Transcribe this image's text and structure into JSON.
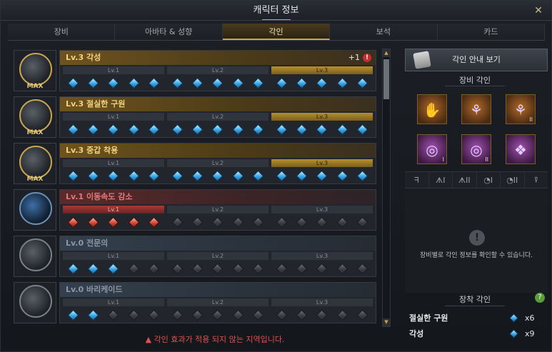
{
  "window": {
    "title": "캐릭터 정보"
  },
  "tabs": [
    {
      "label": "장비",
      "active": false
    },
    {
      "label": "아바타 & 성향",
      "active": false
    },
    {
      "label": "각인",
      "active": true
    },
    {
      "label": "보석",
      "active": false
    },
    {
      "label": "카드",
      "active": false
    }
  ],
  "engravings": [
    {
      "name": "Lv.3 각성",
      "style": "gold",
      "badge": "MAX",
      "extra": "+1",
      "lv1": "Lv.1",
      "lv2": "Lv.2",
      "lv3": "Lv.3",
      "active_level": 3,
      "filled": 15,
      "gem": "blue"
    },
    {
      "name": "Lv.3 절실한 구원",
      "style": "gold",
      "badge": "MAX",
      "extra": "",
      "lv1": "Lv.1",
      "lv2": "Lv.2",
      "lv3": "Lv.3",
      "active_level": 3,
      "filled": 15,
      "gem": "blue"
    },
    {
      "name": "Lv.3 중갑 착용",
      "style": "gold",
      "badge": "MAX",
      "extra": "",
      "lv1": "Lv.1",
      "lv2": "Lv.2",
      "lv3": "Lv.3",
      "active_level": 3,
      "filled": 15,
      "gem": "blue"
    },
    {
      "name": "Lv.1 이동속도 감소",
      "style": "red",
      "badge": "",
      "extra": "",
      "lv1": "Lv.1",
      "lv2": "Lv.2",
      "lv3": "Lv.3",
      "active_level": 1,
      "filled": 5,
      "gem": "red"
    },
    {
      "name": "Lv.0 전문의",
      "style": "grey",
      "badge": "",
      "extra": "",
      "lv1": "Lv.1",
      "lv2": "Lv.2",
      "lv3": "Lv.3",
      "active_level": 0,
      "filled": 3,
      "gem": "blue"
    },
    {
      "name": "Lv.0 바리케이드",
      "style": "grey",
      "badge": "",
      "extra": "",
      "lv1": "Lv.1",
      "lv2": "Lv.2",
      "lv3": "Lv.3",
      "active_level": 0,
      "filled": 2,
      "gem": "blue"
    }
  ],
  "footer_warning": "각인 효과가 적용 되지 않는 지역입니다.",
  "right": {
    "guide_button": "각인 안내 보기",
    "equip_title": "장비 각인",
    "equip_slots": [
      {
        "icon": "gloves-icon",
        "label": ""
      },
      {
        "icon": "necklace-icon",
        "label": ""
      },
      {
        "icon": "necklace-icon",
        "label": "II"
      },
      {
        "icon": "ring-icon",
        "label": "I"
      },
      {
        "icon": "ring-icon",
        "label": "II"
      },
      {
        "icon": "stone-icon",
        "label": ""
      }
    ],
    "slot_filters": [
      "ᖷ",
      "ᗑI",
      "ᗑII",
      "◔I",
      "◔II",
      "⍒"
    ],
    "info_text": "장비별로 각인 정보를 확인할 수 있습니다.",
    "active_title": "장착 각인",
    "active": [
      {
        "name": "절실한 구원",
        "count": "x6"
      },
      {
        "name": "각성",
        "count": "x9"
      }
    ]
  }
}
